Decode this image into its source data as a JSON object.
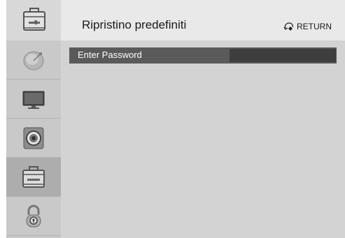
{
  "header": {
    "title": "Ripristino predefiniti",
    "return_label": "RETURN",
    "header_icon": "toolbox-icon"
  },
  "sidebar": {
    "items": [
      {
        "name": "satellite-icon",
        "active": false
      },
      {
        "name": "tv-icon",
        "active": false
      },
      {
        "name": "speaker-icon",
        "active": false
      },
      {
        "name": "toolbox-icon",
        "active": true
      },
      {
        "name": "lock-icon",
        "active": false
      }
    ]
  },
  "main": {
    "password_label": "Enter Password",
    "password_value": ""
  },
  "colors": {
    "selected_row": "#5a5a5a",
    "password_field": "#3e3e3e",
    "sidebar_active": "#adadad",
    "background": "#d3d3d3"
  }
}
